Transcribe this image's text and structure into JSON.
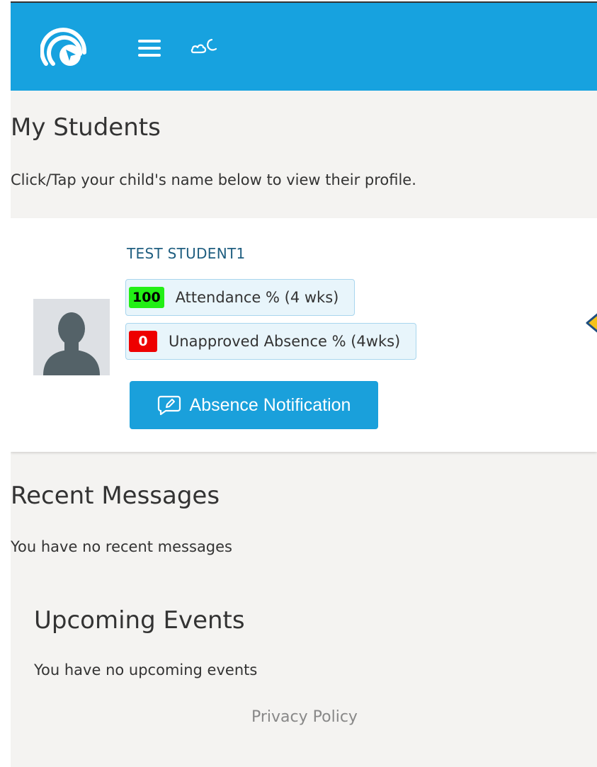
{
  "header": {
    "logo_icon": "app-logo-icon",
    "menu_icon": "hamburger-menu-icon",
    "theme_icon": "cloud-moon-icon",
    "background_color": "#17a2df"
  },
  "main": {
    "title": "My Students",
    "intro": "Click/Tap your child's name below to view their profile."
  },
  "student": {
    "name": "TEST STUDENT1",
    "avatar_icon": "person-silhouette-icon",
    "attendance": {
      "value": "100",
      "label": "Attendance % (4 wks)",
      "badge_color": "#22ef15"
    },
    "unapproved": {
      "value": "0",
      "label": "Unapproved Absence % (4wks)",
      "badge_color": "#ee0000"
    },
    "absence_button": {
      "label": "Absence Notification",
      "icon": "edit-note-icon"
    }
  },
  "recent_messages": {
    "title": "Recent Messages",
    "empty_text": "You have no recent messages"
  },
  "upcoming_events": {
    "title": "Upcoming Events",
    "empty_text": "You have no upcoming events"
  },
  "footer": {
    "privacy_label": "Privacy Policy"
  }
}
